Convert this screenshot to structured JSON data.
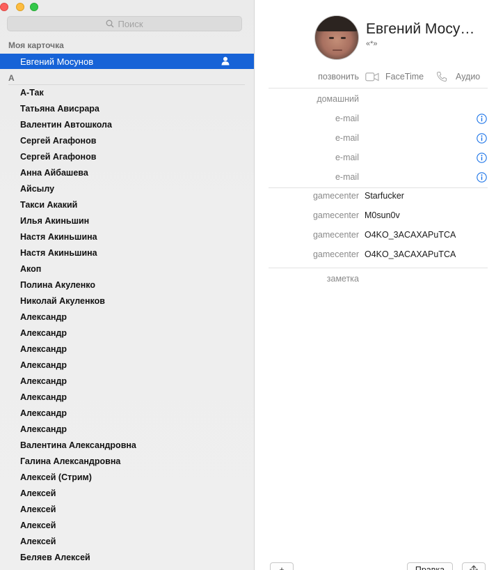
{
  "search": {
    "placeholder": "Поиск"
  },
  "sidebar": {
    "my_card_title": "Моя карточка",
    "my_card_name": "Евгений Мосунов",
    "section_letter": "А",
    "contacts": [
      "А-Так",
      "Татьяна Ависрара",
      "Валентин Автошкола",
      "Сергей Агафонов",
      "Сергей Агафонов",
      "Анна Айбашева",
      "Айсылу",
      "Такси Акакий",
      "Илья Акиньшин",
      "Настя Акиньшина",
      "Настя Акиньшина",
      "Акоп",
      "Полина Акуленко",
      "Николай Акуленков",
      "Александр",
      "Александр",
      "Александр",
      "Александр",
      "Александр",
      "Александр",
      "Александр",
      "Александр",
      "Валентина Александровна",
      "Галина Александровна",
      "Алексей (Стрим)",
      "Алексей",
      "Алексей",
      "Алексей",
      "Алексей",
      "Беляев Алексей"
    ]
  },
  "detail": {
    "name": "Евгений Мосу…",
    "nickname": "«*»",
    "call_label": "позвонить",
    "facetime_label": "FaceTime",
    "audio_label": "Аудио",
    "fields": {
      "home_label": "домашний",
      "email_label": "e-mail",
      "gamecenter_label": "gamecenter",
      "gamecenter_values": [
        "Starfucker",
        "M0sun0v",
        "O4KO_3ACAXAPuTCA",
        "O4KO_3ACAXAPuTCA"
      ],
      "note_label": "заметка"
    }
  },
  "toolbar": {
    "add_label": "+",
    "edit_label": "Правка"
  },
  "colors": {
    "selection": "#1763d7",
    "info_icon": "#1a73e8",
    "close": "#fc605c",
    "minimize": "#fdbc40",
    "maximize": "#34c84a"
  },
  "icons": [
    "search-icon",
    "me-card-icon",
    "facetime-icon",
    "phone-icon",
    "info-icon",
    "share-icon"
  ]
}
